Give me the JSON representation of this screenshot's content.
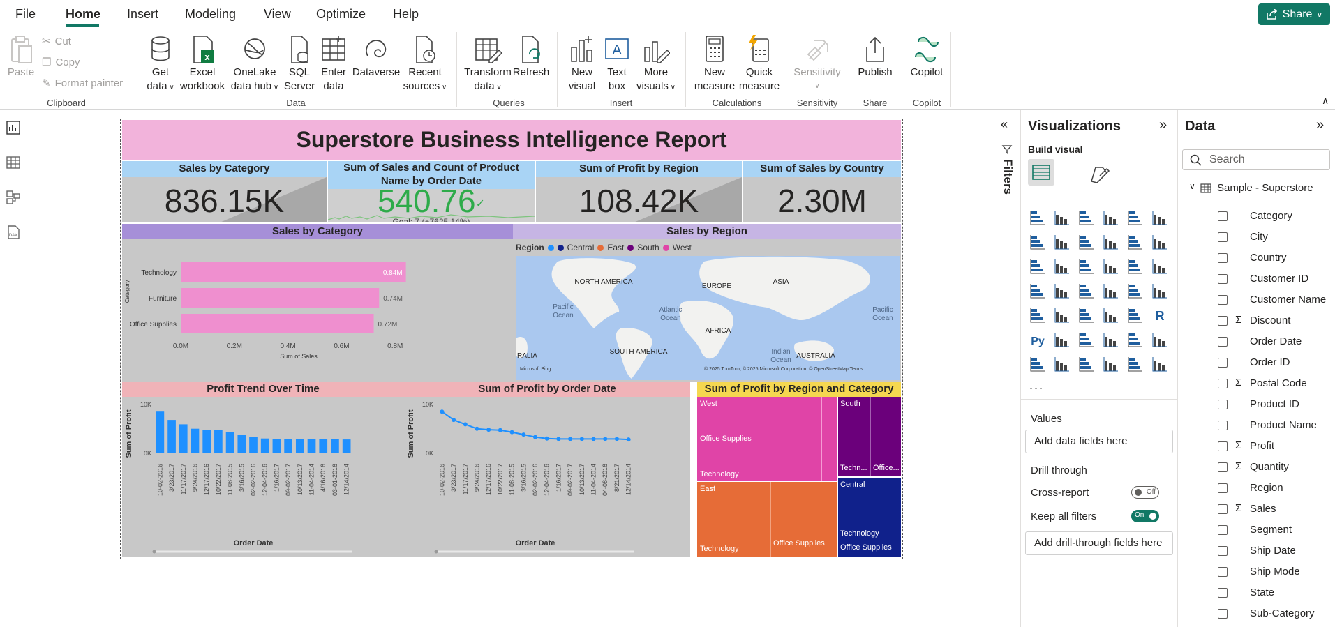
{
  "menubar": {
    "tabs": [
      "File",
      "Home",
      "Insert",
      "Modeling",
      "View",
      "Optimize",
      "Help"
    ],
    "share_label": "Share"
  },
  "ribbon": {
    "clipboard": {
      "paste": "Paste",
      "cut": "Cut",
      "copy": "Copy",
      "format_painter": "Format painter",
      "group": "Clipboard"
    },
    "data": {
      "get_data": [
        "Get",
        "data"
      ],
      "excel": [
        "Excel",
        "workbook"
      ],
      "onelake": [
        "OneLake",
        "data hub"
      ],
      "sql": [
        "SQL",
        "Server"
      ],
      "enter": [
        "Enter",
        "data"
      ],
      "dataverse": [
        "Dataverse"
      ],
      "recent": [
        "Recent",
        "sources"
      ],
      "group": "Data"
    },
    "queries": {
      "transform": [
        "Transform",
        "data"
      ],
      "refresh": [
        "Refresh"
      ],
      "group": "Queries"
    },
    "insert": {
      "new_visual": [
        "New",
        "visual"
      ],
      "text_box": [
        "Text",
        "box"
      ],
      "more_visuals": [
        "More",
        "visuals"
      ],
      "group": "Insert"
    },
    "calculations": {
      "new_measure": [
        "New",
        "measure"
      ],
      "quick_measure": [
        "Quick",
        "measure"
      ],
      "group": "Calculations"
    },
    "sensitivity": {
      "label": [
        "Sensitivity"
      ],
      "group": "Sensitivity"
    },
    "share": {
      "publish": [
        "Publish"
      ],
      "group": "Share"
    },
    "copilot": {
      "label": [
        "Copilot"
      ],
      "group": "Copilot"
    }
  },
  "report": {
    "title": "Superstore Business Intelligence Report",
    "kpis": [
      {
        "header": "Sales by Category",
        "value": "836.15K"
      },
      {
        "header": "Sum of Sales and Count of Product Name by Order Date",
        "value": "540.76",
        "goal": "Goal: 7 (+7625.14%)"
      },
      {
        "header": "Sum of Profit by Region",
        "value": "108.42K"
      },
      {
        "header": "Sum of Sales by Country",
        "value": "2.30M"
      }
    ],
    "sections": {
      "sales_by_category": "Sales by Category",
      "sales_by_region": "Sales by Region",
      "profit_trend": "Profit Trend Over Time",
      "profit_by_date": "Sum of Profit by Order Date",
      "profit_region_category": "Sum of Profit by Region and Category"
    },
    "map": {
      "legend_title": "Region",
      "legend_items": [
        "Central",
        "East",
        "South",
        "West"
      ],
      "labels": [
        "NORTH AMERICA",
        "EUROPE",
        "ASIA",
        "Pacific",
        "Ocean",
        "Atlantic",
        "Ocean",
        "AFRICA",
        "SOUTH AMERICA",
        "Indian",
        "Ocean",
        "AUSTRALIA",
        "Pacific",
        "Ocean",
        "RALIA"
      ],
      "attribution": "© 2025 TomTom, © 2025 Microsoft Corporation, © OpenStreetMap  Terms",
      "bing": "Microsoft Bing"
    },
    "treemap": {
      "tiles": [
        {
          "region": "West",
          "category": "Office Supplies"
        },
        {
          "region": "",
          "category": "Technology"
        },
        {
          "region": "South",
          "category": "Techn..."
        },
        {
          "region": "",
          "category": "Office..."
        },
        {
          "region": "East",
          "category": "Technology"
        },
        {
          "region": "",
          "category": "Office Supplies"
        },
        {
          "region": "Central",
          "category": "Technology"
        },
        {
          "region": "",
          "category": "Office Supplies"
        }
      ]
    }
  },
  "chart_data": [
    {
      "type": "bar",
      "orientation": "horizontal",
      "title": "Sales by Category",
      "categories": [
        "Technology",
        "Furniture",
        "Office Supplies"
      ],
      "values": [
        0.84,
        0.74,
        0.72
      ],
      "data_labels": [
        "0.84M",
        "0.74M",
        "0.72M"
      ],
      "xlabel": "Sum of Sales",
      "ylabel": "Category",
      "xticks": [
        "0.0M",
        "0.2M",
        "0.4M",
        "0.6M",
        "0.8M"
      ],
      "xlim": [
        0,
        0.88
      ],
      "color": "#ef8fcf"
    },
    {
      "type": "bar",
      "title": "Profit Trend Over Time",
      "categories": [
        "10-02-2016",
        "3/23/2017",
        "11/17/2017",
        "9/24/2016",
        "12/17/2016",
        "10/22/2017",
        "11-08-2015",
        "3/16/2015",
        "02-02-2016",
        "12-04-2016",
        "1/16/2017",
        "09-02-2017",
        "10/13/2017",
        "11-04-2014",
        "4/16/2016",
        "03-01-2016",
        "12/14/2014"
      ],
      "values": [
        8400,
        6700,
        5800,
        4900,
        4700,
        4600,
        4200,
        3700,
        3200,
        2900,
        2800,
        2800,
        2800,
        2800,
        2800,
        2800,
        2700
      ],
      "xlabel": "Order Date",
      "ylabel": "Sum of Profit",
      "yticks": [
        "10K",
        "0K"
      ],
      "ylim": [
        0,
        10000
      ],
      "color": "#1e90ff"
    },
    {
      "type": "line",
      "title": "Sum of Profit by Order Date",
      "categories": [
        "10-02-2016",
        "3/23/2017",
        "11/17/2017",
        "9/24/2016",
        "12/17/2016",
        "10/22/2017",
        "11-08-2015",
        "3/16/2015",
        "02-02-2016",
        "12-04-2016",
        "1/16/2017",
        "09-02-2017",
        "10/13/2017",
        "11-04-2014",
        "04-08-2016",
        "8/21/2017",
        "12/14/2014"
      ],
      "values": [
        8400,
        6700,
        5800,
        4900,
        4700,
        4600,
        4200,
        3700,
        3200,
        2900,
        2800,
        2800,
        2800,
        2800,
        2800,
        2800,
        2700
      ],
      "xlabel": "Order Date",
      "ylabel": "Sum of Profit",
      "yticks": [
        "10K",
        "0K"
      ],
      "ylim": [
        0,
        10000
      ],
      "color": "#1e90ff"
    }
  ],
  "filters": {
    "label": "Filters"
  },
  "visualizations": {
    "title": "Visualizations",
    "build_visual": "Build visual",
    "more": "...",
    "values_label": "Values",
    "values_placeholder": "Add data fields here",
    "drill_through": "Drill through",
    "cross_report": "Cross-report",
    "cross_report_state": "Off",
    "keep_filters": "Keep all filters",
    "keep_filters_state": "On",
    "drill_placeholder": "Add drill-through fields here"
  },
  "data_pane": {
    "title": "Data",
    "search_placeholder": "Search",
    "table": "Sample - Superstore",
    "fields": [
      {
        "name": "Category",
        "sigma": false
      },
      {
        "name": "City",
        "sigma": false
      },
      {
        "name": "Country",
        "sigma": false
      },
      {
        "name": "Customer ID",
        "sigma": false
      },
      {
        "name": "Customer Name",
        "sigma": false
      },
      {
        "name": "Discount",
        "sigma": true
      },
      {
        "name": "Order Date",
        "sigma": false
      },
      {
        "name": "Order ID",
        "sigma": false
      },
      {
        "name": "Postal Code",
        "sigma": true
      },
      {
        "name": "Product ID",
        "sigma": false
      },
      {
        "name": "Product Name",
        "sigma": false
      },
      {
        "name": "Profit",
        "sigma": true
      },
      {
        "name": "Quantity",
        "sigma": true
      },
      {
        "name": "Region",
        "sigma": false
      },
      {
        "name": "Sales",
        "sigma": true
      },
      {
        "name": "Segment",
        "sigma": false
      },
      {
        "name": "Ship Date",
        "sigma": false
      },
      {
        "name": "Ship Mode",
        "sigma": false
      },
      {
        "name": "State",
        "sigma": false
      },
      {
        "name": "Sub-Category",
        "sigma": false
      }
    ]
  },
  "colors": {
    "accent": "#117865",
    "bar_pink": "#ef8fcf",
    "bar_blue": "#1e90ff",
    "title_band": "#f2b3db",
    "kpi_head": "#a9d4f5"
  }
}
